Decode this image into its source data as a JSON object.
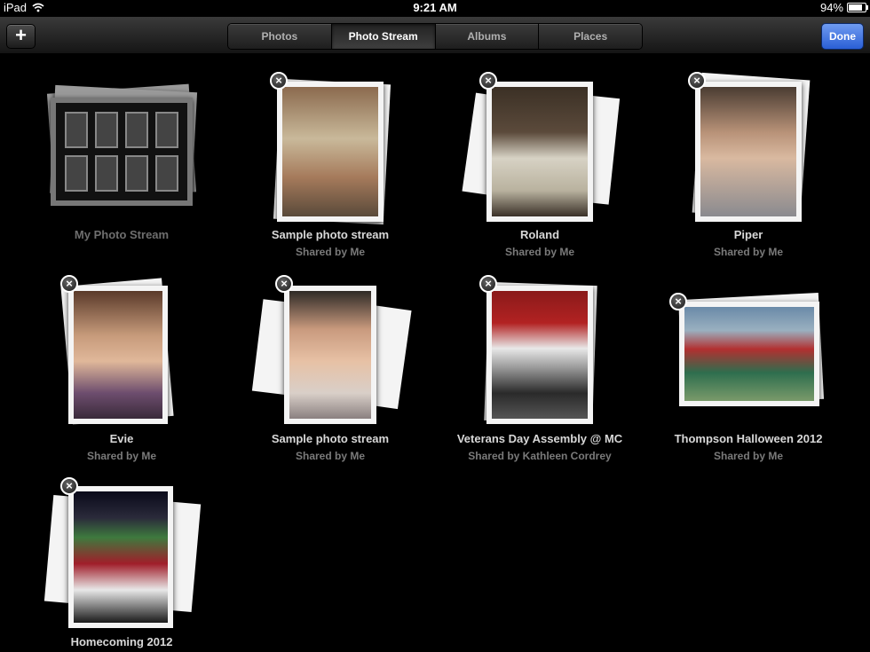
{
  "status_bar": {
    "device": "iPad",
    "time": "9:21 AM",
    "battery": "94%",
    "battery_level": 0.94
  },
  "toolbar": {
    "add_label": "+",
    "segments": [
      "Photos",
      "Photo Stream",
      "Albums",
      "Places"
    ],
    "active_segment": "Photo Stream",
    "done_label": "Done"
  },
  "streams": [
    {
      "title": "My Photo Stream",
      "subtitle": "",
      "deletable": false
    },
    {
      "title": "Sample photo stream",
      "subtitle": "Shared by Me",
      "deletable": true
    },
    {
      "title": "Roland",
      "subtitle": "Shared by Me",
      "deletable": true
    },
    {
      "title": "Piper",
      "subtitle": "Shared by Me",
      "deletable": true
    },
    {
      "title": "Evie",
      "subtitle": "Shared by Me",
      "deletable": true
    },
    {
      "title": "Sample photo stream",
      "subtitle": "Shared by Me",
      "deletable": true
    },
    {
      "title": "Veterans Day Assembly @ MC",
      "subtitle": "Shared by Kathleen Cordrey",
      "deletable": true
    },
    {
      "title": "Thompson Halloween 2012",
      "subtitle": "Shared by Me",
      "deletable": true
    },
    {
      "title": "Homecoming 2012",
      "subtitle": "",
      "deletable": true
    }
  ],
  "delete_glyph": "×",
  "colors": {
    "done_button": "#2a5fd6",
    "background": "#000000"
  }
}
